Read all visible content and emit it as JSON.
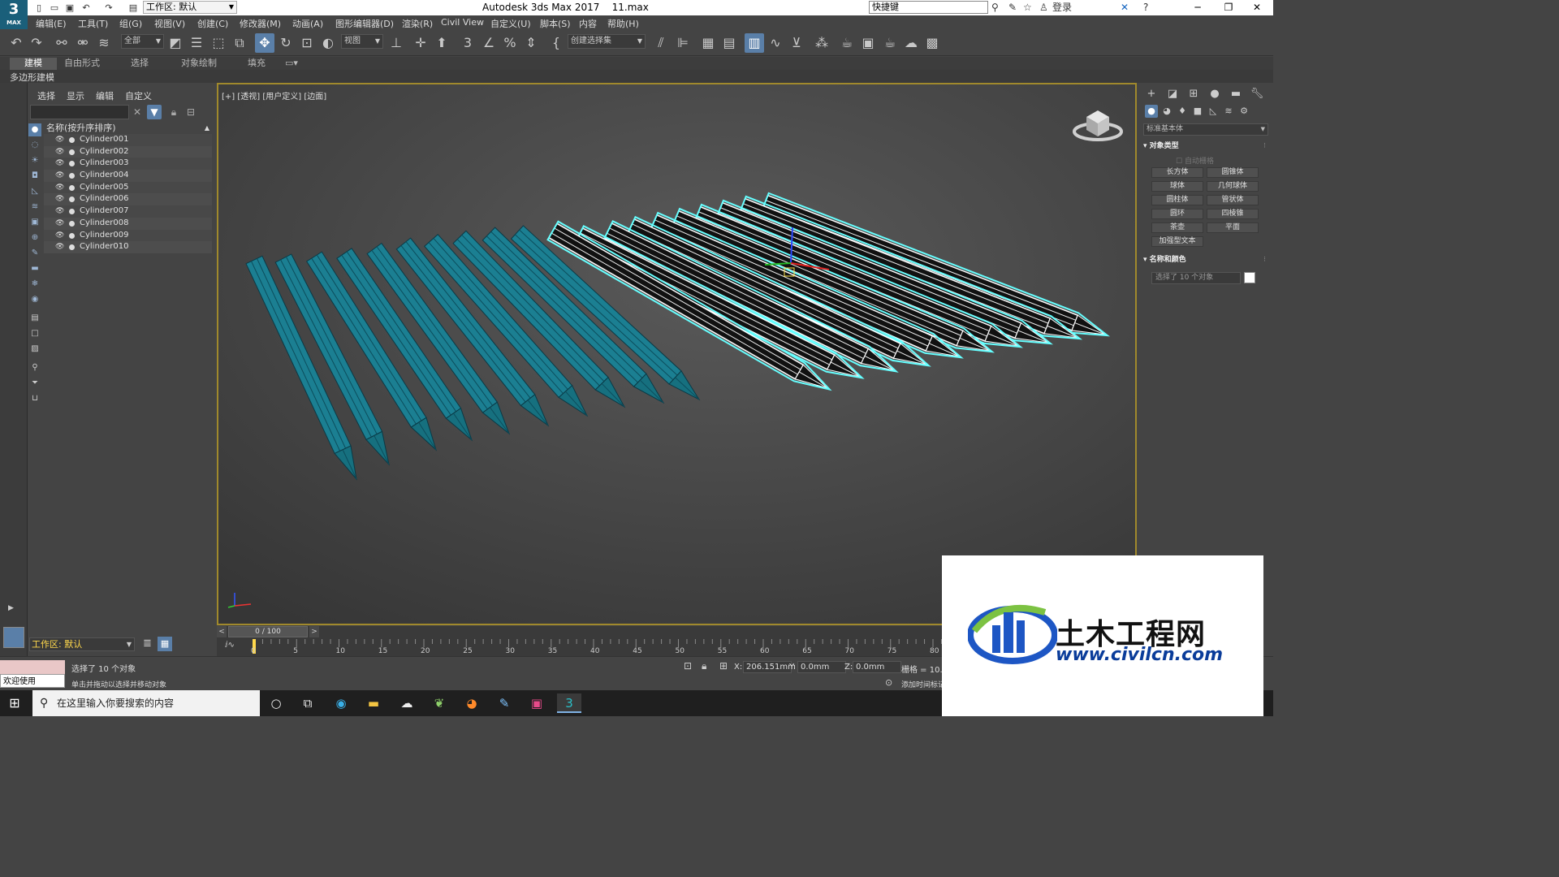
{
  "app": {
    "logo_number": "3",
    "logo_text": "MAX",
    "workspace_label": "工作区: 默认",
    "window_title": "Autodesk 3ds Max 2017",
    "file_name": "11.max",
    "search_value": "快捷键",
    "login_label": "登录",
    "window_controls": [
      "─",
      "❐",
      "✕"
    ]
  },
  "menu": {
    "items": [
      "编辑(E)",
      "工具(T)",
      "组(G)",
      "视图(V)",
      "创建(C)",
      "修改器(M)",
      "动画(A)",
      "图形编辑器(D)",
      "渲染(R)",
      "Civil View",
      "自定义(U)",
      "脚本(S)",
      "内容",
      "帮助(H)"
    ]
  },
  "toolbar": {
    "filter_value": "全部",
    "refcoord_value": "视图",
    "selection_set_value": "创建选择集"
  },
  "ribbon": {
    "tabs": [
      "建模",
      "自由形式",
      "选择",
      "对象绘制",
      "填充"
    ],
    "active_tab": "建模",
    "sub_label": "多边形建模"
  },
  "explorer": {
    "menu": [
      "选择",
      "显示",
      "编辑",
      "自定义"
    ],
    "column_header": "名称(按升序排序)",
    "objects": [
      "Cylinder001",
      "Cylinder002",
      "Cylinder003",
      "Cylinder004",
      "Cylinder005",
      "Cylinder006",
      "Cylinder007",
      "Cylinder008",
      "Cylinder009",
      "Cylinder010"
    ],
    "workspace_footer": "工作区: 默认"
  },
  "viewport": {
    "label": "[+] [透视] [用户定义] [边面]"
  },
  "command_panel": {
    "category_value": "标准基本体",
    "rollout_object_type": "对象类型",
    "autogrid_label": "自动栅格",
    "primitives": [
      "长方体",
      "圆锥体",
      "球体",
      "几何球体",
      "圆柱体",
      "管状体",
      "圆环",
      "四棱锥",
      "茶壶",
      "平面",
      "加强型文本"
    ],
    "rollout_name_color": "名称和颜色",
    "name_field_placeholder": "选择了 10 个对象"
  },
  "timeline": {
    "frame_display": "0 / 100",
    "ticks": [
      "0",
      "5",
      "10",
      "15",
      "20",
      "25",
      "30",
      "35",
      "40",
      "45",
      "50",
      "55",
      "60",
      "65",
      "70",
      "75",
      "80"
    ]
  },
  "status": {
    "maxscript_label": "欢迎使用 MAXSc",
    "selected_text": "选择了 10 个对象",
    "prompt_text": "单击并拖动以选择并移动对象",
    "x_label": "X:",
    "x_value": "206.151mm",
    "y_label": "Y:",
    "y_value": "0.0mm",
    "z_label": "Z:",
    "z_value": "0.0mm",
    "grid_text": "栅格 = 10.0mm",
    "add_time_tag": "添加时间标记"
  },
  "taskbar": {
    "search_placeholder": "在这里输入你要搜索的内容"
  },
  "watermark": {
    "title": "土木工程网",
    "url": "www.civilcn.com"
  },
  "colors": {
    "object_teal": "#1b7f92",
    "selection_outline": "#66ffff",
    "viewport_border": "#a0892c",
    "accent_blue": "#5a7fa8"
  }
}
